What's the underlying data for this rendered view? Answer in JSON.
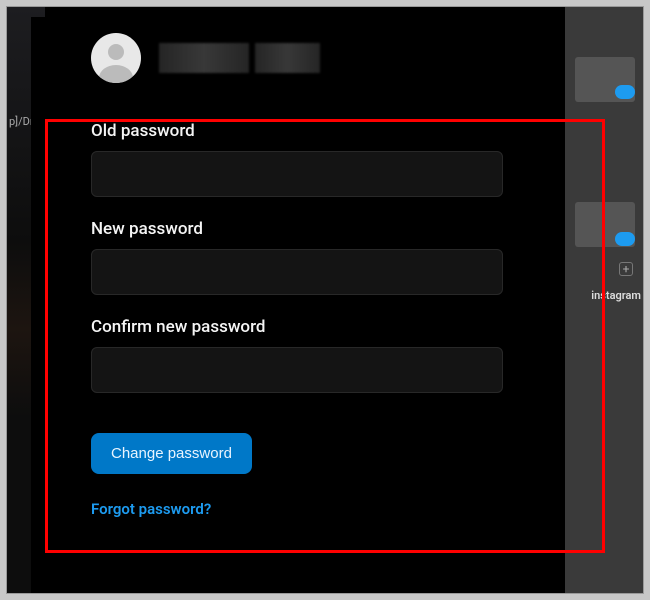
{
  "profile": {
    "username_redacted": true
  },
  "form": {
    "old_password": {
      "label": "Old password",
      "value": ""
    },
    "new_password": {
      "label": "New password",
      "value": ""
    },
    "confirm_password": {
      "label": "Confirm new password",
      "value": ""
    },
    "submit_label": "Change password"
  },
  "links": {
    "forgot": "Forgot password?"
  },
  "background": {
    "left_fragment": "p]/Dr",
    "right_title": "instagram",
    "right_plus": "+"
  }
}
